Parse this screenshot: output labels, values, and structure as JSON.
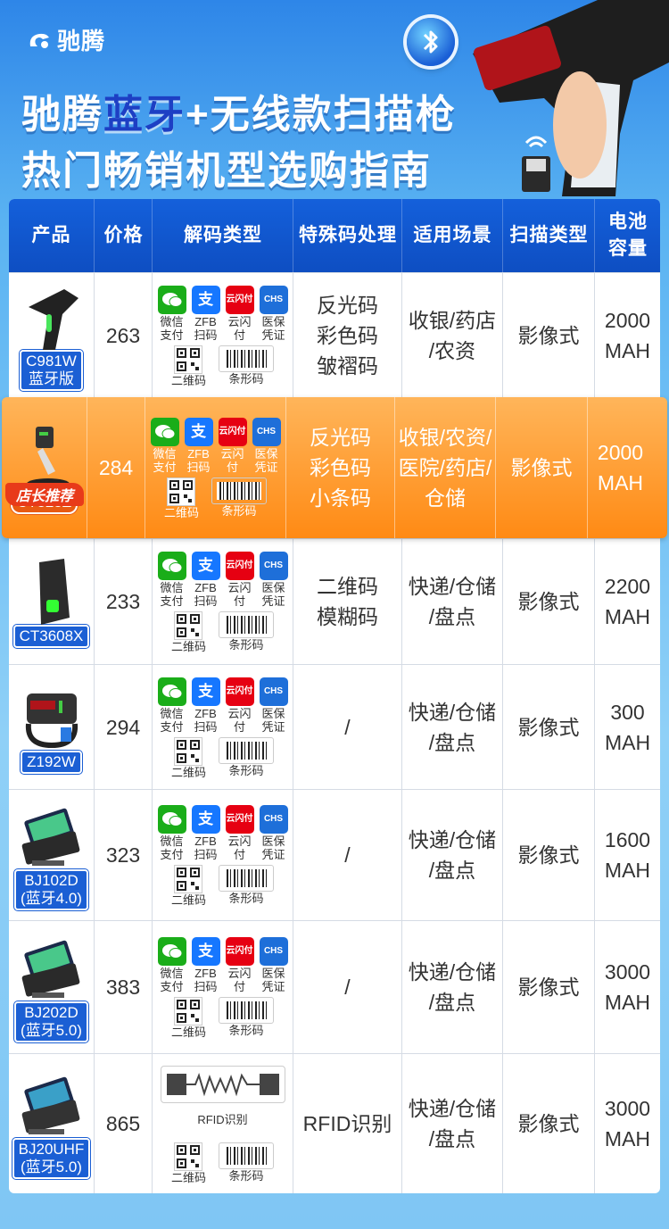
{
  "brand": {
    "name": "驰腾"
  },
  "headline": {
    "line1_pre": "驰腾",
    "line1_accent": "蓝牙",
    "line1_post": "+无线款扫描枪",
    "line2": "热门畅销机型选购指南"
  },
  "colors": {
    "header_blue": "#1460db",
    "featured_orange": "#ff8a14",
    "name_tag_blue": "#1b5fd4"
  },
  "table": {
    "headers": [
      "产品",
      "价格",
      "解码类型",
      "特殊码处理",
      "适用场景",
      "扫描类型",
      "电池\n容量"
    ],
    "pay_labels": {
      "wechat": "微信\n支付",
      "alipay": "ZFB\n扫码",
      "unionpay": "云闪付",
      "chs": "医保\n凭证"
    },
    "pay_icon_text": {
      "alipay": "支",
      "unionpay": "云闪付",
      "chs": "CHS"
    },
    "code_labels": {
      "qr": "二维码",
      "barcode": "条形码",
      "rfid": "RFID识别"
    },
    "recommend_badge": "店长推荐",
    "rows": [
      {
        "name": "C981W\n蓝牙版",
        "price": "263",
        "special": "反光码\n彩色码\n皱褶码",
        "scene": "收银/药店\n/农资",
        "scan": "影像式",
        "battery": "2000\nMAH"
      },
      {
        "name": "CT825Z",
        "price": "284",
        "special": "反光码\n彩色码\n小条码",
        "scene": "收银/农资/\n医院/药店/\n仓储",
        "scan": "影像式",
        "battery": "2000\nMAH"
      },
      {
        "name": "CT3608X",
        "price": "233",
        "special": "二维码\n模糊码",
        "scene": "快递/仓储\n/盘点",
        "scan": "影像式",
        "battery": "2200\nMAH"
      },
      {
        "name": "Z192W",
        "price": "294",
        "special": "/",
        "scene": "快递/仓储\n/盘点",
        "scan": "影像式",
        "battery": "300\nMAH"
      },
      {
        "name": "BJ102D\n(蓝牙4.0)",
        "price": "323",
        "special": "/",
        "scene": "快递/仓储\n/盘点",
        "scan": "影像式",
        "battery": "1600\nMAH"
      },
      {
        "name": "BJ202D\n(蓝牙5.0)",
        "price": "383",
        "special": "/",
        "scene": "快递/仓储\n/盘点",
        "scan": "影像式",
        "battery": "3000\nMAH"
      },
      {
        "name": "BJ20UHF\n(蓝牙5.0)",
        "price": "865",
        "special": "RFID识别",
        "scene": "快递/仓储\n/盘点",
        "scan": "影像式",
        "battery": "3000\nMAH"
      }
    ]
  }
}
